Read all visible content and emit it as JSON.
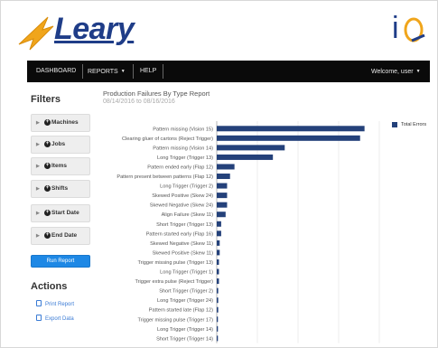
{
  "brand": {
    "logo_text": "Leary",
    "iq_letter": "i",
    "colors": {
      "logo_blue": "#1f3d88",
      "logo_orange": "#f0a51b",
      "bar_navy": "#24417a",
      "accent_blue": "#1e88e5"
    }
  },
  "navbar": {
    "dashboard": "DASHBOARD",
    "reports": "REPORTS",
    "help": "HELP",
    "welcome": "Welcome, user"
  },
  "sidebar": {
    "filters_title": "Filters",
    "filters": [
      "Machines",
      "Jobs",
      "Items",
      "Shifts",
      "Start Date",
      "End Date"
    ],
    "run_button": "Run Report",
    "actions_title": "Actions",
    "actions": [
      {
        "label": "Print Report",
        "icon": "print-icon"
      },
      {
        "label": "Export Data",
        "icon": "export-icon"
      }
    ]
  },
  "report": {
    "title": "Production Failures By Type Report",
    "date_range": "08/14/2016 to 08/16/2016"
  },
  "chart_data": {
    "type": "bar",
    "orientation": "horizontal",
    "categories": [
      "Pattern missing (Vision 15)",
      "Clearing gluer of cartons (Reject Trigger)",
      "Pattern missing (Vision 14)",
      "Long Trigger (Trigger 13)",
      "Pattern ended early (Flap 12)",
      "Pattern present between patterns (Flap 12)",
      "Long Trigger (Trigger 2)",
      "Skewed Positive (Skew 24)",
      "Skewed Negative (Skew 24)",
      "Align Failure (Skew 11)",
      "Short Trigger (Trigger 13)",
      "Pattern started early (Flap 16)",
      "Skewed Negative (Skew 11)",
      "Skewed Positive (Skew 11)",
      "Trigger missing pulse (Trigger 13)",
      "Long Trigger (Trigger 1)",
      "Trigger extra pulse (Reject Trigger)",
      "Short Trigger (Trigger 2)",
      "Long Trigger (Trigger 24)",
      "Pattern started late (Flap 12)",
      "Trigger missing pulse (Trigger 17)",
      "Long Trigger (Trigger 14)",
      "Short Trigger (Trigger 14)"
    ],
    "series": [
      {
        "name": "Total Errors",
        "color": "#24417a",
        "values": [
          100,
          97,
          46,
          38,
          12,
          9,
          7,
          7,
          7,
          6,
          3,
          3,
          2,
          2,
          1.5,
          1.5,
          1.5,
          1,
          1,
          1,
          0.8,
          0.8,
          0.8
        ]
      }
    ],
    "xlim": [
      0,
      110
    ],
    "grid": true,
    "legend_position": "top-right"
  }
}
